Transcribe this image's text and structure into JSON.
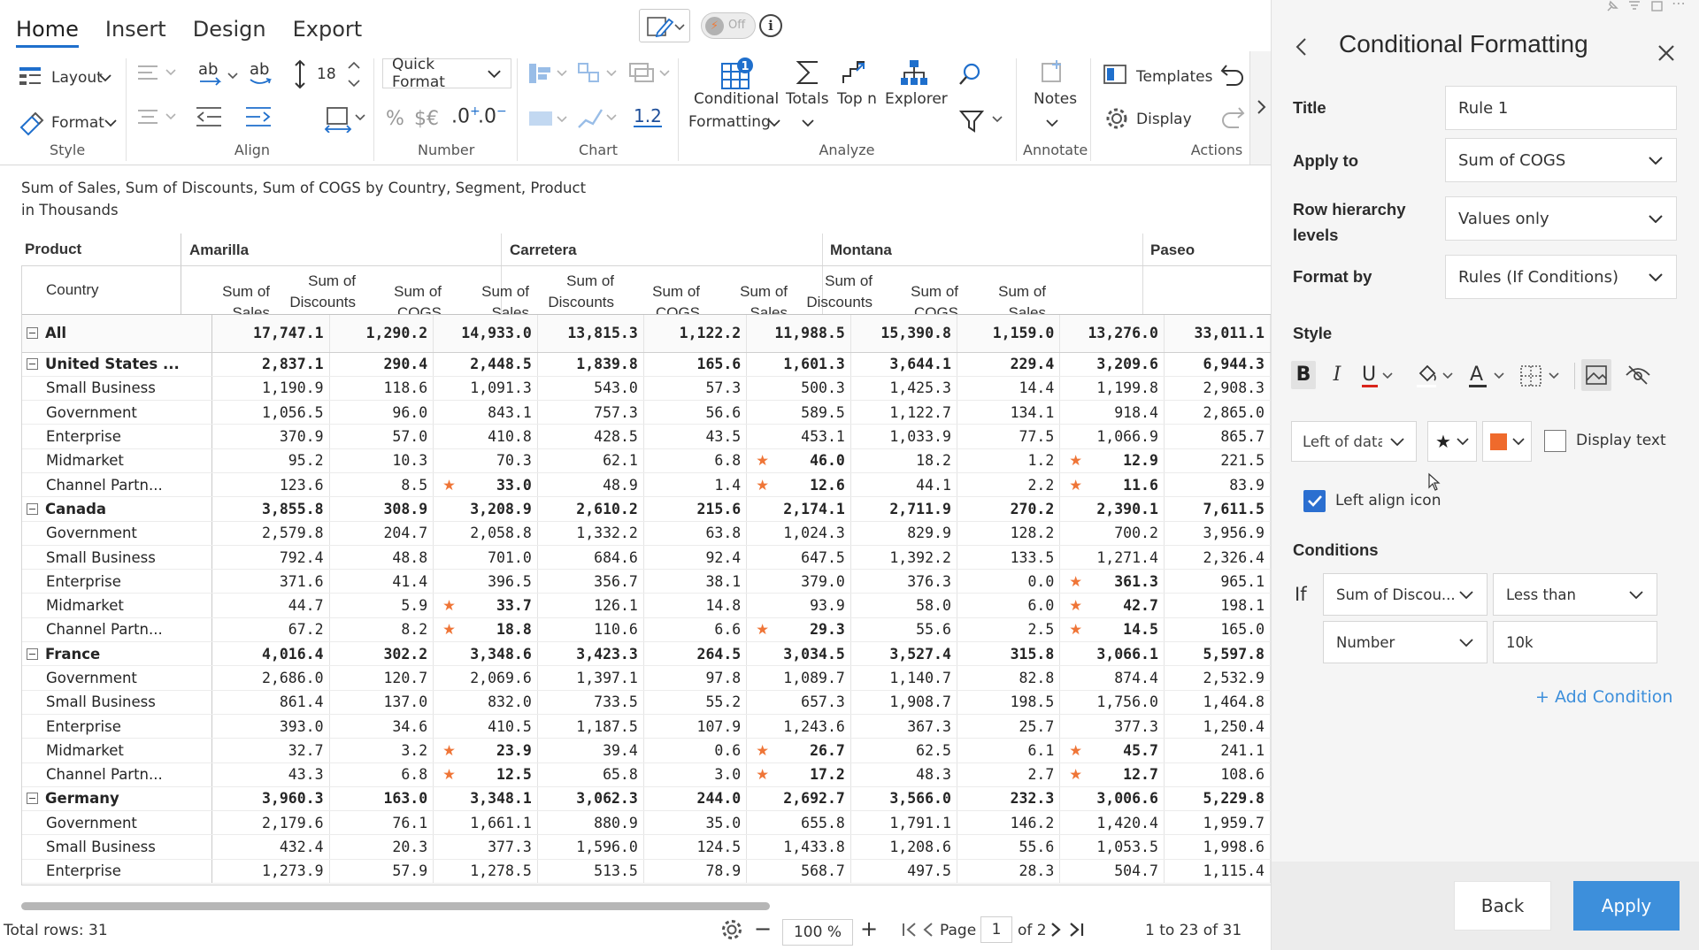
{
  "ribbon": {
    "tabs": [
      "Home",
      "Insert",
      "Design",
      "Export"
    ],
    "active_tab": "Home",
    "toggle_label": "Off",
    "style": {
      "layout_label": "Layout",
      "format_label": "Format",
      "group_label": "Style"
    },
    "align": {
      "font_size": "18",
      "group_label": "Align"
    },
    "number": {
      "quick_format": "Quick Format",
      "percent": "%",
      "currency": "$€",
      "inc_decimal": ".0",
      "dec_decimal": ".0",
      "group_label": "Number"
    },
    "chart": {
      "value": "1.2",
      "group_label": "Chart"
    },
    "analyze": {
      "conditional": "Conditional",
      "formatting": "Formatting",
      "totals": "Totals",
      "topn": "Top n",
      "explorer": "Explorer",
      "group_label": "Analyze",
      "badge": "1"
    },
    "annotate": {
      "notes": "Notes",
      "group_label": "Annotate"
    },
    "actions": {
      "templates": "Templates",
      "display": "Display",
      "group_label": "Actions"
    }
  },
  "report": {
    "subtitle_line1": "Sum of Sales, Sum of Discounts, Sum of COGS by Country, Segment, Product",
    "subtitle_line2": "in Thousands"
  },
  "grid": {
    "row_header": "Product",
    "country_header": "Country",
    "products": [
      "Amarilla",
      "Carretera",
      "Montana",
      "Paseo"
    ],
    "measures": [
      "Sum of Sales",
      "Sum of Discounts",
      "Sum of COGS",
      "Sum of Sales",
      "Sum of Discounts",
      "Sum of COGS",
      "Sum of Sales",
      "Sum of Discounts",
      "Sum of COGS",
      "Sum of Sales"
    ],
    "rows": [
      {
        "label": "All",
        "level": 0,
        "bold": true,
        "all": true,
        "values": [
          "17,747.1",
          "1,290.2",
          "14,933.0",
          "13,815.3",
          "1,122.2",
          "11,988.5",
          "15,390.8",
          "1,159.0",
          "13,276.0",
          "33,011.1"
        ],
        "stars": []
      },
      {
        "label": "United States ...",
        "level": 0,
        "bold": true,
        "values": [
          "2,837.1",
          "290.4",
          "2,448.5",
          "1,839.8",
          "165.6",
          "1,601.3",
          "3,644.1",
          "229.4",
          "3,209.6",
          "6,944.3"
        ],
        "stars": []
      },
      {
        "label": "Small Business",
        "level": 1,
        "values": [
          "1,190.9",
          "118.6",
          "1,091.3",
          "543.0",
          "57.3",
          "500.3",
          "1,425.3",
          "14.4",
          "1,199.8",
          "2,908.3"
        ],
        "stars": []
      },
      {
        "label": "Government",
        "level": 1,
        "values": [
          "1,056.5",
          "96.0",
          "843.1",
          "757.3",
          "56.6",
          "589.5",
          "1,122.7",
          "134.1",
          "918.4",
          "2,865.0"
        ],
        "stars": []
      },
      {
        "label": "Enterprise",
        "level": 1,
        "values": [
          "370.9",
          "57.0",
          "410.8",
          "428.5",
          "43.5",
          "453.1",
          "1,033.9",
          "77.5",
          "1,066.9",
          "865.7"
        ],
        "stars": []
      },
      {
        "label": "Midmarket",
        "level": 1,
        "values": [
          "95.2",
          "10.3",
          "70.3",
          "62.1",
          "6.8",
          "46.0",
          "18.2",
          "1.2",
          "12.9",
          "221.5"
        ],
        "stars": [
          5,
          8
        ]
      },
      {
        "label": "Channel Partn...",
        "level": 1,
        "values": [
          "123.6",
          "8.5",
          "33.0",
          "48.9",
          "1.4",
          "12.6",
          "44.1",
          "2.2",
          "11.6",
          "83.9"
        ],
        "stars": [
          2,
          5,
          8
        ]
      },
      {
        "label": "Canada",
        "level": 0,
        "bold": true,
        "values": [
          "3,855.8",
          "308.9",
          "3,208.9",
          "2,610.2",
          "215.6",
          "2,174.1",
          "2,711.9",
          "270.2",
          "2,390.1",
          "7,611.5"
        ],
        "stars": []
      },
      {
        "label": "Government",
        "level": 1,
        "values": [
          "2,579.8",
          "204.7",
          "2,058.8",
          "1,332.2",
          "63.8",
          "1,024.3",
          "829.9",
          "128.2",
          "700.2",
          "3,956.9"
        ],
        "stars": []
      },
      {
        "label": "Small Business",
        "level": 1,
        "values": [
          "792.4",
          "48.8",
          "701.0",
          "684.6",
          "92.4",
          "647.5",
          "1,392.2",
          "133.5",
          "1,271.4",
          "2,326.4"
        ],
        "stars": []
      },
      {
        "label": "Enterprise",
        "level": 1,
        "values": [
          "371.6",
          "41.4",
          "396.5",
          "356.7",
          "38.1",
          "379.0",
          "376.3",
          "0.0",
          "361.3",
          "965.1"
        ],
        "stars": [
          8
        ]
      },
      {
        "label": "Midmarket",
        "level": 1,
        "values": [
          "44.7",
          "5.9",
          "33.7",
          "126.1",
          "14.8",
          "93.9",
          "58.0",
          "6.0",
          "42.7",
          "198.1"
        ],
        "stars": [
          2,
          8
        ]
      },
      {
        "label": "Channel Partn...",
        "level": 1,
        "values": [
          "67.2",
          "8.2",
          "18.8",
          "110.6",
          "6.6",
          "29.3",
          "55.6",
          "2.5",
          "14.5",
          "165.0"
        ],
        "stars": [
          2,
          5,
          8
        ]
      },
      {
        "label": "France",
        "level": 0,
        "bold": true,
        "values": [
          "4,016.4",
          "302.2",
          "3,348.6",
          "3,423.3",
          "264.5",
          "3,034.5",
          "3,527.4",
          "315.8",
          "3,066.1",
          "5,597.8"
        ],
        "stars": []
      },
      {
        "label": "Government",
        "level": 1,
        "values": [
          "2,686.0",
          "120.7",
          "2,069.6",
          "1,397.1",
          "97.8",
          "1,089.7",
          "1,140.7",
          "82.8",
          "874.4",
          "2,532.9"
        ],
        "stars": []
      },
      {
        "label": "Small Business",
        "level": 1,
        "values": [
          "861.4",
          "137.0",
          "832.0",
          "733.5",
          "55.2",
          "657.3",
          "1,908.7",
          "198.5",
          "1,756.0",
          "1,464.8"
        ],
        "stars": []
      },
      {
        "label": "Enterprise",
        "level": 1,
        "values": [
          "393.0",
          "34.6",
          "410.5",
          "1,187.5",
          "107.9",
          "1,243.6",
          "367.3",
          "25.7",
          "377.3",
          "1,250.4"
        ],
        "stars": []
      },
      {
        "label": "Midmarket",
        "level": 1,
        "values": [
          "32.7",
          "3.2",
          "23.9",
          "39.4",
          "0.6",
          "26.7",
          "62.5",
          "6.1",
          "45.7",
          "241.1"
        ],
        "stars": [
          2,
          5,
          8
        ]
      },
      {
        "label": "Channel Partn...",
        "level": 1,
        "values": [
          "43.3",
          "6.8",
          "12.5",
          "65.8",
          "3.0",
          "17.2",
          "48.3",
          "2.7",
          "12.7",
          "108.6"
        ],
        "stars": [
          2,
          5,
          8
        ]
      },
      {
        "label": "Germany",
        "level": 0,
        "bold": true,
        "values": [
          "3,960.3",
          "163.0",
          "3,348.1",
          "3,062.3",
          "244.0",
          "2,692.7",
          "3,566.0",
          "232.3",
          "3,006.6",
          "5,229.8"
        ],
        "stars": []
      },
      {
        "label": "Government",
        "level": 1,
        "values": [
          "2,179.6",
          "76.1",
          "1,661.1",
          "880.9",
          "35.0",
          "655.8",
          "1,791.1",
          "146.2",
          "1,420.4",
          "1,959.7"
        ],
        "stars": []
      },
      {
        "label": "Small Business",
        "level": 1,
        "values": [
          "432.4",
          "20.3",
          "377.3",
          "1,596.0",
          "124.5",
          "1,433.8",
          "1,208.6",
          "55.6",
          "1,053.5",
          "1,998.6"
        ],
        "stars": []
      },
      {
        "label": "Enterprise",
        "level": 1,
        "values": [
          "1,273.9",
          "57.9",
          "1,278.5",
          "513.5",
          "78.9",
          "568.7",
          "497.5",
          "28.3",
          "504.7",
          "1,115.4"
        ],
        "stars": []
      }
    ],
    "star_color": "#ef7537",
    "bold_star_cells": true
  },
  "status": {
    "total_rows": "Total rows: 31",
    "zoom": "100 %",
    "page_label": "Page",
    "page_value": "1",
    "page_of": "of 2",
    "range": "1 to 23 of 31"
  },
  "panel": {
    "title": "Conditional Formatting",
    "title_label": "Title",
    "title_value": "Rule 1",
    "apply_to_label": "Apply to",
    "apply_to_value": "Sum of COGS",
    "row_hierarchy_label_1": "Row hierarchy",
    "row_hierarchy_label_2": "levels",
    "row_hierarchy_value": "Values only",
    "format_by_label": "Format by",
    "format_by_value": "Rules (If Conditions)",
    "style_label": "Style",
    "icon_position": "Left of data",
    "display_text_label": "Display text",
    "display_text_checked": false,
    "left_align_label": "Left align icon",
    "left_align_checked": true,
    "icon_color": "#ef6a2c",
    "conditions_label": "Conditions",
    "if_label": "If",
    "cond_field": "Sum of Discou...",
    "cond_operator": "Less than",
    "cond_type": "Number",
    "cond_value": "10k",
    "add_condition": "+ Add Condition",
    "back_button": "Back",
    "apply_button": "Apply",
    "accent": "#3d8fdb"
  }
}
